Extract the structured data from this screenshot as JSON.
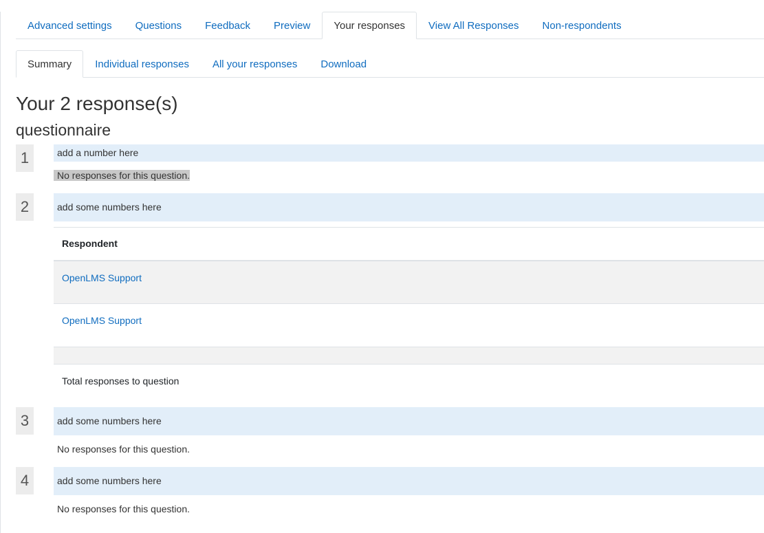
{
  "primary_tabs": [
    {
      "label": "Advanced settings",
      "active": false
    },
    {
      "label": "Questions",
      "active": false
    },
    {
      "label": "Feedback",
      "active": false
    },
    {
      "label": "Preview",
      "active": false
    },
    {
      "label": "Your responses",
      "active": true
    },
    {
      "label": "View All Responses",
      "active": false
    },
    {
      "label": "Non-respondents",
      "active": false
    }
  ],
  "secondary_tabs": [
    {
      "label": "Summary",
      "active": true
    },
    {
      "label": "Individual responses",
      "active": false
    },
    {
      "label": "All your responses",
      "active": false
    },
    {
      "label": "Download",
      "active": false
    }
  ],
  "page_title": "Your 2 response(s)",
  "questionnaire_name": "questionnaire",
  "questions": [
    {
      "number": "1",
      "text": "add a number here",
      "no_response": "No responses for this question."
    },
    {
      "number": "2",
      "text": "add some numbers here",
      "table": {
        "header": "Respondent",
        "rows": [
          "OpenLMS Support",
          "OpenLMS Support"
        ],
        "total_label": "Total responses to question"
      }
    },
    {
      "number": "3",
      "text": "add some numbers here",
      "no_response": "No responses for this question."
    },
    {
      "number": "4",
      "text": "add some numbers here",
      "no_response": "No responses for this question."
    }
  ]
}
